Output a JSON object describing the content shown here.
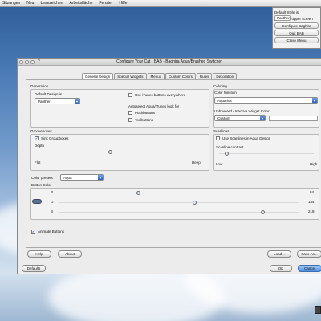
{
  "menubar": {
    "items": [
      "Sitzungen",
      "Neu",
      "Lesezeichen",
      "Arbeitsfläche",
      "Fenster",
      "Hilfe"
    ]
  },
  "popup": {
    "label": "Default Style is",
    "style_value": "Panther",
    "round_label": "Round upper screen",
    "round_checked": true,
    "configure_label": "Configure Baghira",
    "quit_label": "Quit BAB",
    "close_label": "Close Menu"
  },
  "window": {
    "title": "Configure Your Cat - BAB - Baghira Aqua/Brushed Switcher",
    "help_symbol": "?"
  },
  "tabs": [
    "General Design",
    "Special Widgets",
    "Menus",
    "Custom Colors",
    "Rules",
    "Decoration"
  ],
  "generation": {
    "title": "Generation",
    "default_design_label": "Default Design is",
    "design_value": "Panther",
    "itunes_label": "Use iTunes buttons everywhere",
    "autoselect_label": "Autoselect Aqua/iTunes look for",
    "pushbuttons_label": "Pushbuttons",
    "toolbuttons_label": "Toolbuttons",
    "itunes_checked": false,
    "pushbuttons_checked": false,
    "toolbuttons_checked": false
  },
  "coloring": {
    "title": "Coloring",
    "color_function_label": "Color function",
    "color_function_value": "Aquarius",
    "unhovered_label": "Unhovered / Inactive Widget Color",
    "unhovered_value": "Custom"
  },
  "grooves": {
    "title": "Grooveboxes",
    "sink_label": "Sink Groupboxes",
    "sink_checked": true,
    "depth_label": "Depth",
    "flat_label": "Flat",
    "deep_label": "Deep",
    "depth_fraction": 0.45
  },
  "scanlines": {
    "title": "Scanlines",
    "use_label": "Use Scanlines in Aqua Design",
    "use_checked": false,
    "contrast_label": "Scanline contrast",
    "low_label": "Low",
    "high_label": "High",
    "contrast_fraction": 0.06
  },
  "color_presets": {
    "label": "Color presets",
    "value": "Aqua"
  },
  "button_color": {
    "title": "Button Color",
    "r_label": "R",
    "g_label": "G",
    "b_label": "B",
    "r": 84,
    "g": 144,
    "b": 218,
    "r_text": "84",
    "g_text": "144",
    "b_text": "218",
    "swatch_color": "#54748f"
  },
  "animate": {
    "label": "Animate Buttons",
    "checked": true
  },
  "buttons": {
    "help": "Help",
    "about": "About",
    "load": "Load...",
    "save_as": "Save As...",
    "defaults": "Defaults",
    "ok": "OK",
    "cancel": "Cancel"
  }
}
